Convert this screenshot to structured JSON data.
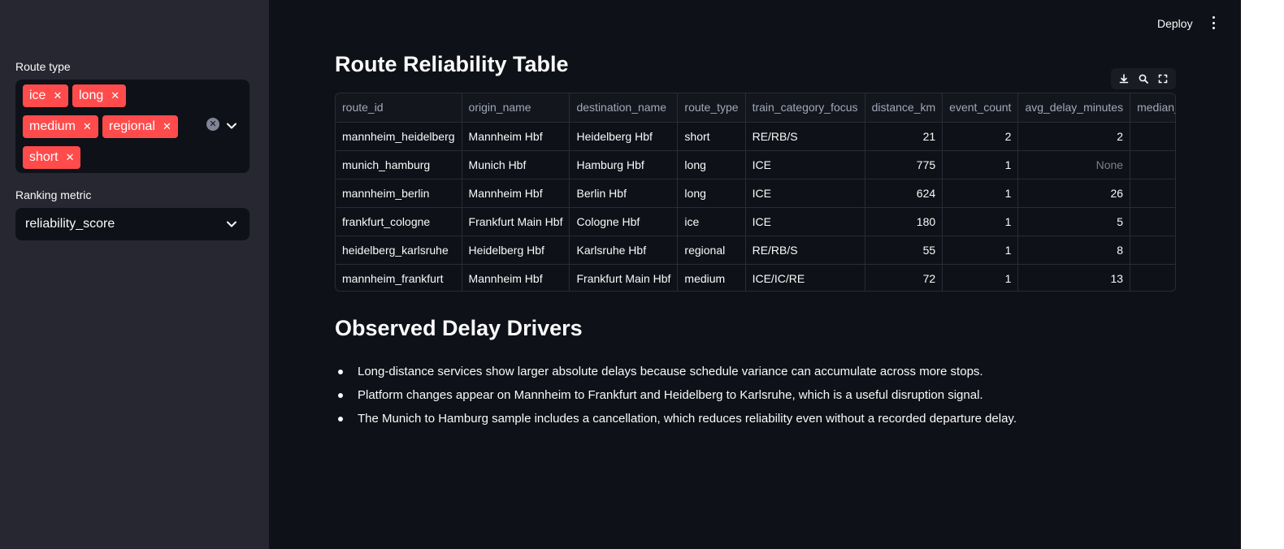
{
  "header": {
    "deploy_label": "Deploy"
  },
  "sidebar": {
    "route_type_label": "Route type",
    "route_type_selected": [
      "ice",
      "long",
      "medium",
      "regional",
      "short"
    ],
    "ranking_metric_label": "Ranking metric",
    "ranking_metric_value": "reliability_score"
  },
  "main": {
    "table_title": "Route Reliability Table",
    "table": {
      "columns": [
        "route_id",
        "origin_name",
        "destination_name",
        "route_type",
        "train_category_focus",
        "distance_km",
        "event_count",
        "avg_delay_minutes",
        "median_delay_minutes"
      ],
      "rows": [
        [
          "mannheim_heidelberg",
          "Mannheim Hbf",
          "Heidelberg Hbf",
          "short",
          "RE/RB/S",
          "21",
          "2",
          "2",
          ""
        ],
        [
          "munich_hamburg",
          "Munich Hbf",
          "Hamburg Hbf",
          "long",
          "ICE",
          "775",
          "1",
          "None",
          ""
        ],
        [
          "mannheim_berlin",
          "Mannheim Hbf",
          "Berlin Hbf",
          "long",
          "ICE",
          "624",
          "1",
          "26",
          ""
        ],
        [
          "frankfurt_cologne",
          "Frankfurt Main Hbf",
          "Cologne Hbf",
          "ice",
          "ICE",
          "180",
          "1",
          "5",
          ""
        ],
        [
          "heidelberg_karlsruhe",
          "Heidelberg Hbf",
          "Karlsruhe Hbf",
          "regional",
          "RE/RB/S",
          "55",
          "1",
          "8",
          ""
        ],
        [
          "mannheim_frankfurt",
          "Mannheim Hbf",
          "Frankfurt Main Hbf",
          "medium",
          "ICE/IC/RE",
          "72",
          "1",
          "13",
          ""
        ]
      ]
    },
    "drivers_title": "Observed Delay Drivers",
    "drivers": [
      "Long-distance services show larger absolute delays because schedule variance can accumulate across more stops.",
      "Platform changes appear on Mannheim to Frankfurt and Heidelberg to Karlsruhe, which is a useful disruption signal.",
      "The Munich to Hamburg sample includes a cancellation, which reduces reliability even without a recorded departure delay."
    ]
  },
  "colors": {
    "app_bg": "#0e1117",
    "sidebar_bg": "#262730",
    "tag_bg": "#ff4b4b",
    "text": "#fafafa"
  }
}
